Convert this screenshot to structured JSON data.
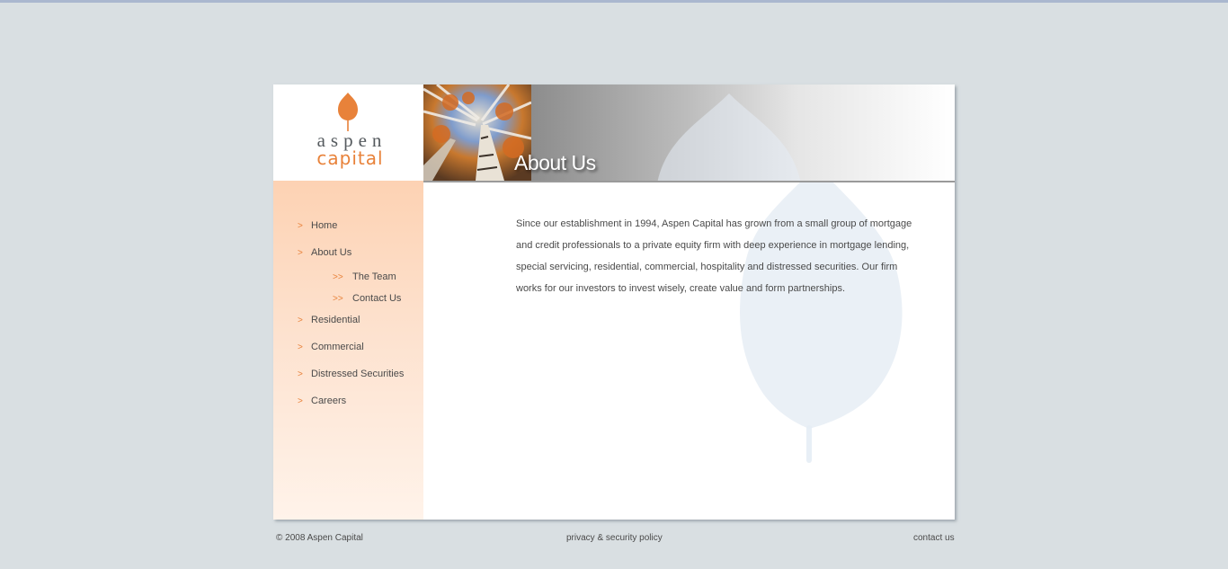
{
  "brand": {
    "logo_word1": "aspen",
    "logo_word2": "capital",
    "accent_color": "#e8823a"
  },
  "header": {
    "title": "About Us"
  },
  "nav": {
    "items": [
      {
        "arrow": ">",
        "label": "Home"
      },
      {
        "arrow": ">",
        "label": "About Us"
      },
      {
        "arrow": ">>",
        "label": "The Team"
      },
      {
        "arrow": ">>",
        "label": "Contact Us"
      },
      {
        "arrow": ">",
        "label": "Residential"
      },
      {
        "arrow": ">",
        "label": "Commercial"
      },
      {
        "arrow": ">",
        "label": "Distressed Securities"
      },
      {
        "arrow": ">",
        "label": "Careers"
      }
    ]
  },
  "content": {
    "paragraph": "Since our establishment in 1994, Aspen Capital has grown from a small group of mortgage and credit professionals to a private equity firm with deep experience in mortgage lending, special servicing, residential, commercial, hospitality and distressed securities. Our firm works for our investors to invest wisely, create value and form partnerships."
  },
  "footer": {
    "copyright": "© 2008 Aspen Capital",
    "privacy": "privacy & security policy",
    "contact": "contact us"
  }
}
